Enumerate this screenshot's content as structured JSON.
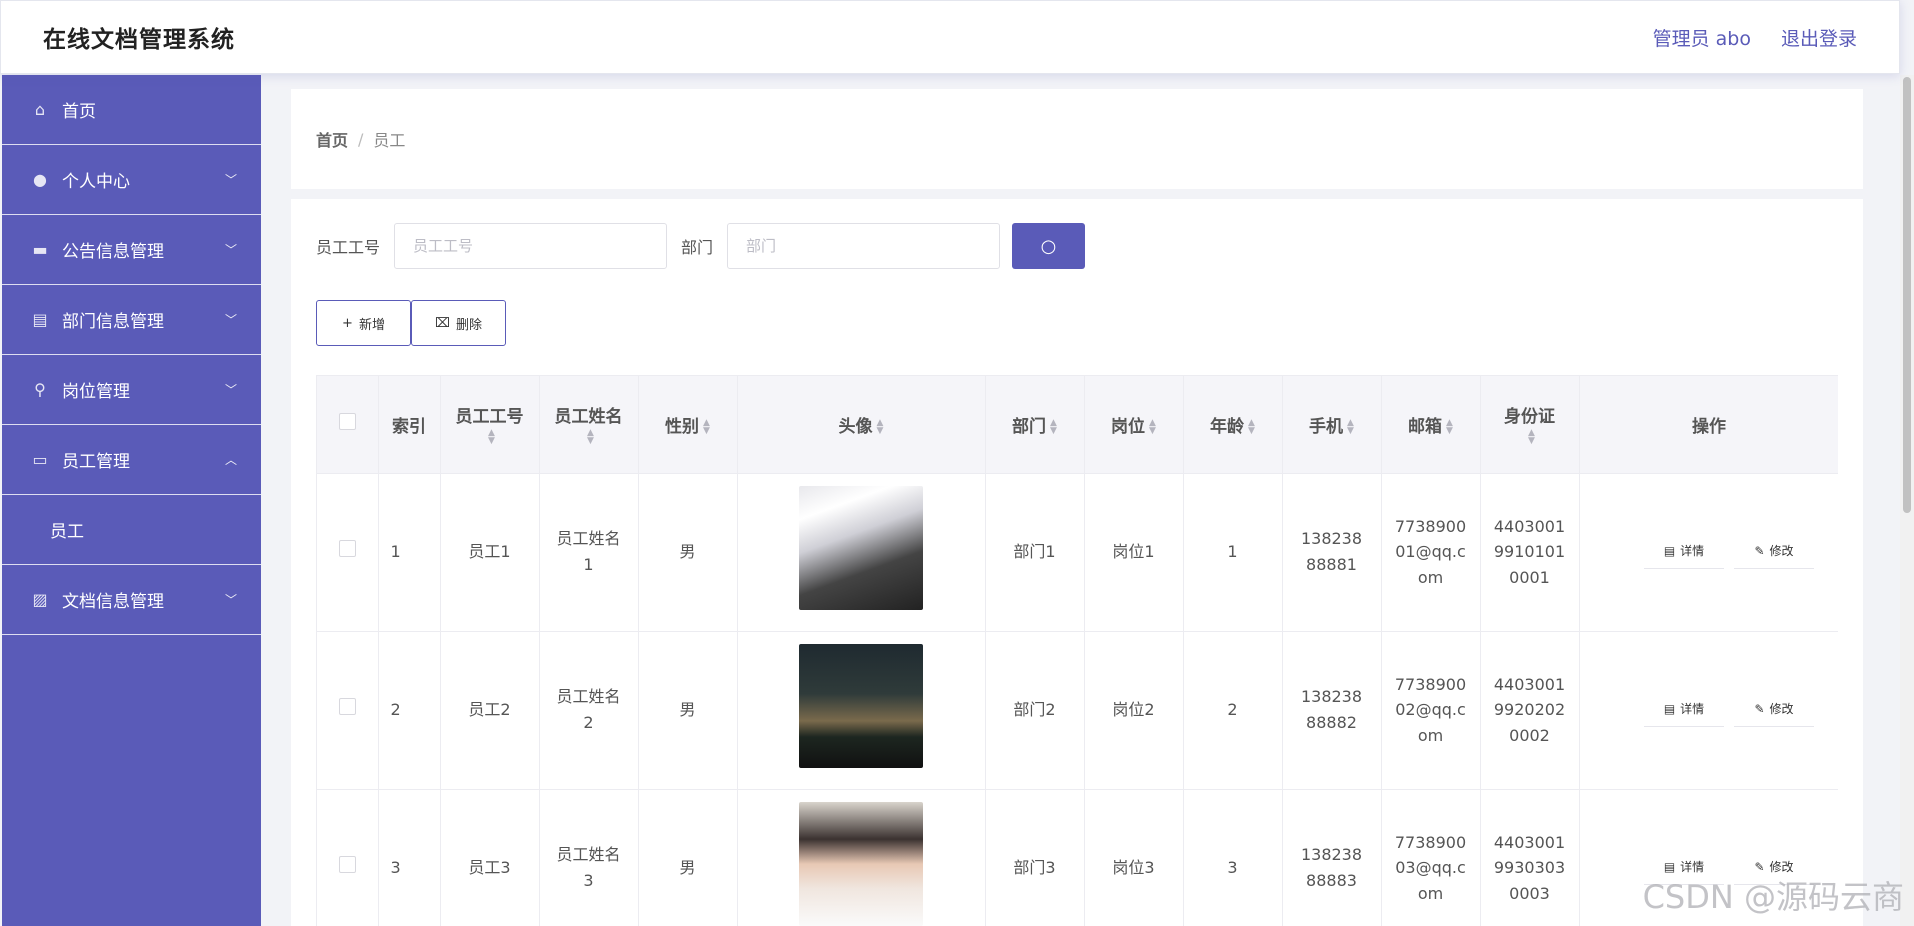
{
  "header": {
    "title": "在线文档管理系统",
    "user": "管理员 abo",
    "logout": "退出登录"
  },
  "sidebar": {
    "items": [
      {
        "label": "首页",
        "icon": "home-icon"
      },
      {
        "label": "个人中心",
        "icon": "user-icon"
      },
      {
        "label": "公告信息管理",
        "icon": "notice-icon"
      },
      {
        "label": "部门信息管理",
        "icon": "briefcase-icon"
      },
      {
        "label": "岗位管理",
        "icon": "microphone-icon"
      },
      {
        "label": "员工管理",
        "icon": "chat-icon"
      },
      {
        "label": "文档信息管理",
        "icon": "chart-icon"
      }
    ],
    "sub_item": "员工"
  },
  "breadcrumb": {
    "home": "首页",
    "sep": "/",
    "current": "员工"
  },
  "search": {
    "id_label": "员工工号",
    "id_placeholder": "员工工号",
    "dept_label": "部门",
    "dept_placeholder": "部门"
  },
  "actions": {
    "add": "新增",
    "delete": "删除"
  },
  "table": {
    "headers": {
      "index": "索引",
      "emp_no": "员工工号",
      "emp_name": "员工姓名",
      "gender": "性别",
      "avatar": "头像",
      "dept": "部门",
      "post": "岗位",
      "age": "年龄",
      "phone": "手机",
      "email": "邮箱",
      "idcard": "身份证",
      "ops": "操作"
    },
    "rows": [
      {
        "index": "1",
        "emp_no": "员工1",
        "emp_name": "员工姓名1",
        "gender": "男",
        "dept": "部门1",
        "post": "岗位1",
        "age": "1",
        "phone": "13823888881",
        "email": "773890001@qq.com",
        "idcard": "440300199101010001"
      },
      {
        "index": "2",
        "emp_no": "员工2",
        "emp_name": "员工姓名2",
        "gender": "男",
        "dept": "部门2",
        "post": "岗位2",
        "age": "2",
        "phone": "13823888882",
        "email": "773890002@qq.com",
        "idcard": "440300199202020002"
      },
      {
        "index": "3",
        "emp_no": "员工3",
        "emp_name": "员工姓名3",
        "gender": "男",
        "dept": "部门3",
        "post": "岗位3",
        "age": "3",
        "phone": "13823888883",
        "email": "773890003@qq.com",
        "idcard": "440300199303030003"
      }
    ],
    "op_detail": "详情",
    "op_edit": "修改"
  },
  "watermark": "CSDN @源码云商"
}
